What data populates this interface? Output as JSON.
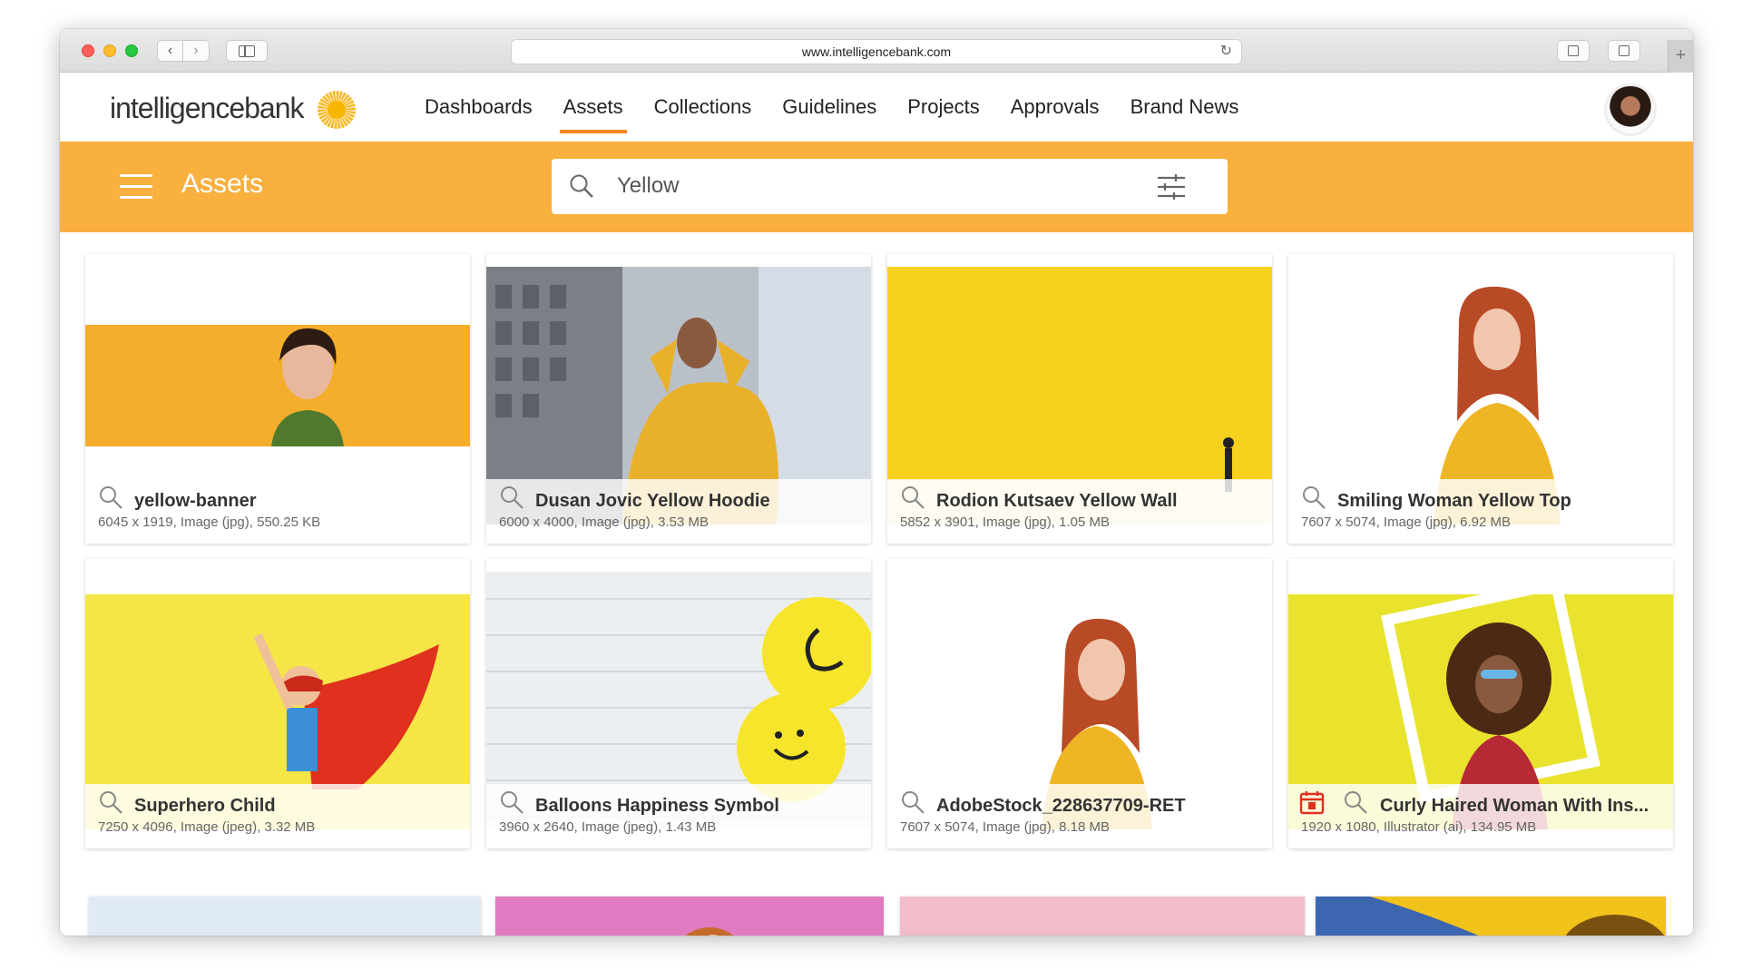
{
  "browser": {
    "url": "www.intelligencebank.com",
    "back_icon": "‹",
    "forward_icon": "›",
    "reload_icon": "↻",
    "newtab_icon": "+"
  },
  "nav": {
    "logo_text": "intelligencebank",
    "links": [
      "Dashboards",
      "Assets",
      "Collections",
      "Guidelines",
      "Projects",
      "Approvals",
      "Brand News"
    ],
    "active": "Assets"
  },
  "header": {
    "page_title": "Assets",
    "search_value": "Yellow",
    "accent_color": "#f9b03f"
  },
  "assets": [
    {
      "title": "yellow-banner",
      "meta": "6045 x 1919, Image (jpg), 550.25 KB"
    },
    {
      "title": "Dusan Jovic Yellow Hoodie",
      "meta": "6000 x 4000, Image (jpg), 3.53 MB"
    },
    {
      "title": "Rodion Kutsaev Yellow Wall",
      "meta": "5852 x 3901, Image (jpg), 1.05 MB"
    },
    {
      "title": "Smiling Woman Yellow Top",
      "meta": "7607 x 5074, Image (jpg), 6.92 MB"
    },
    {
      "title": "Superhero Child",
      "meta": "7250 x 4096, Image (jpeg), 3.32 MB"
    },
    {
      "title": "Balloons Happiness Symbol",
      "meta": "3960 x 2640, Image (jpeg), 1.43 MB"
    },
    {
      "title": "AdobeStock_228637709-RET",
      "meta": "7607 x 5074, Image (jpg), 8.18 MB"
    },
    {
      "title": "Curly Haired Woman With Ins...",
      "meta": "1920 x 1080, Illustrator (ai), 134.95 MB"
    }
  ]
}
